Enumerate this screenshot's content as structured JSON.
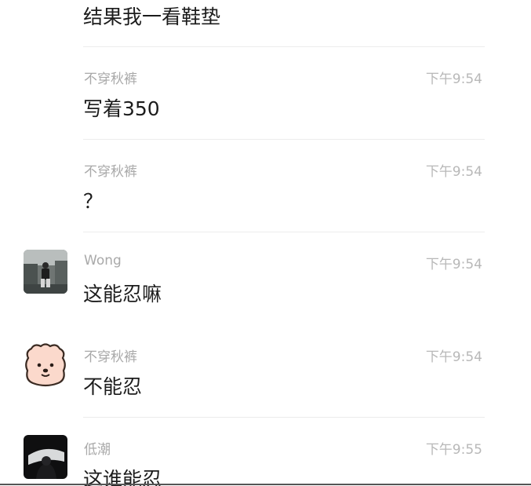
{
  "messages": [
    {
      "sender": "",
      "time": "",
      "text": "结果我一看鞋垫",
      "avatar": ""
    },
    {
      "sender": "不穿秋裤",
      "time": "下午9:54",
      "text": "写着350",
      "avatar": ""
    },
    {
      "sender": "不穿秋裤",
      "time": "下午9:54",
      "text": "？",
      "avatar": ""
    },
    {
      "sender": "Wong",
      "time": "下午9:54",
      "text": "这能忍嘛",
      "avatar": "photo-avatar"
    },
    {
      "sender": "不穿秋裤",
      "time": "下午9:54",
      "text": "不能忍",
      "avatar": "bear-face-avatar"
    },
    {
      "sender": "低潮",
      "time": "下午9:55",
      "text": "这谁能忍",
      "avatar": "dark-photo-avatar"
    }
  ]
}
